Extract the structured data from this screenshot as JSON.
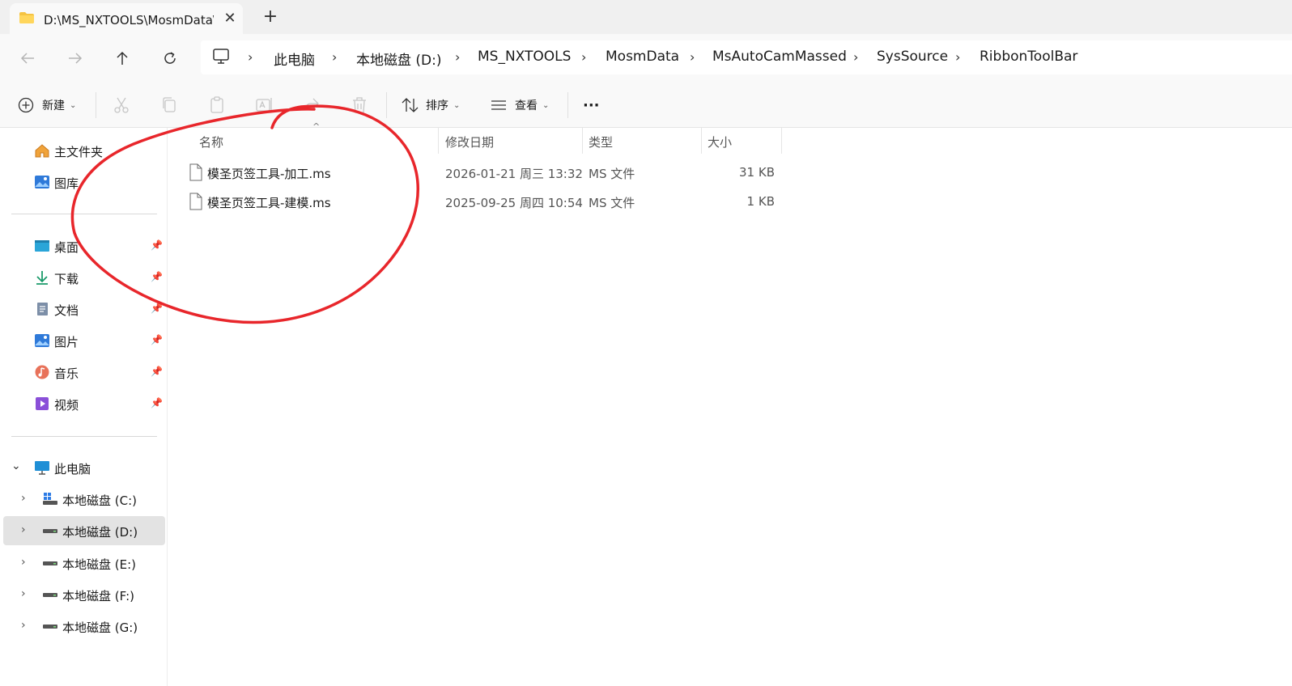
{
  "tab": {
    "title": "D:\\MS_NXTOOLS\\MosmData\\I",
    "close": "✕",
    "new": "+"
  },
  "nav": {
    "breadcrumbs": [
      "此电脑",
      "本地磁盘 (D:)",
      "MS_NXTOOLS",
      "MosmData",
      "MsAutoCamMassed",
      "SysSource",
      "RibbonToolBar"
    ]
  },
  "toolbar": {
    "new_label": "新建",
    "sort_label": "排序",
    "view_label": "查看",
    "more_label": "···"
  },
  "sidebar": {
    "quick": [
      {
        "label": "主文件夹",
        "icon": "home-icon"
      },
      {
        "label": "图库",
        "icon": "gallery-icon"
      }
    ],
    "pinned": [
      {
        "label": "桌面",
        "icon": "desktop-icon"
      },
      {
        "label": "下载",
        "icon": "download-icon"
      },
      {
        "label": "文档",
        "icon": "document-icon"
      },
      {
        "label": "图片",
        "icon": "pictures-icon"
      },
      {
        "label": "音乐",
        "icon": "music-icon"
      },
      {
        "label": "视频",
        "icon": "video-icon"
      }
    ],
    "this_pc": "此电脑",
    "drives": [
      {
        "label": "本地磁盘 (C:)"
      },
      {
        "label": "本地磁盘 (D:)"
      },
      {
        "label": "本地磁盘 (E:)"
      },
      {
        "label": "本地磁盘 (F:)"
      },
      {
        "label": "本地磁盘 (G:)"
      }
    ]
  },
  "list": {
    "columns": [
      "名称",
      "修改日期",
      "类型",
      "大小"
    ],
    "rows": [
      {
        "name": "模圣页签工具-加工.ms",
        "date": "2026-01-21 周三 13:32",
        "type": "MS 文件",
        "size": "31 KB"
      },
      {
        "name": "模圣页签工具-建模.ms",
        "date": "2025-09-25 周四 10:54",
        "type": "MS 文件",
        "size": "1 KB"
      }
    ]
  },
  "colors": {
    "annotation": "#e8262b",
    "selection": "#e3e3e3",
    "folder": "#f5c342"
  }
}
